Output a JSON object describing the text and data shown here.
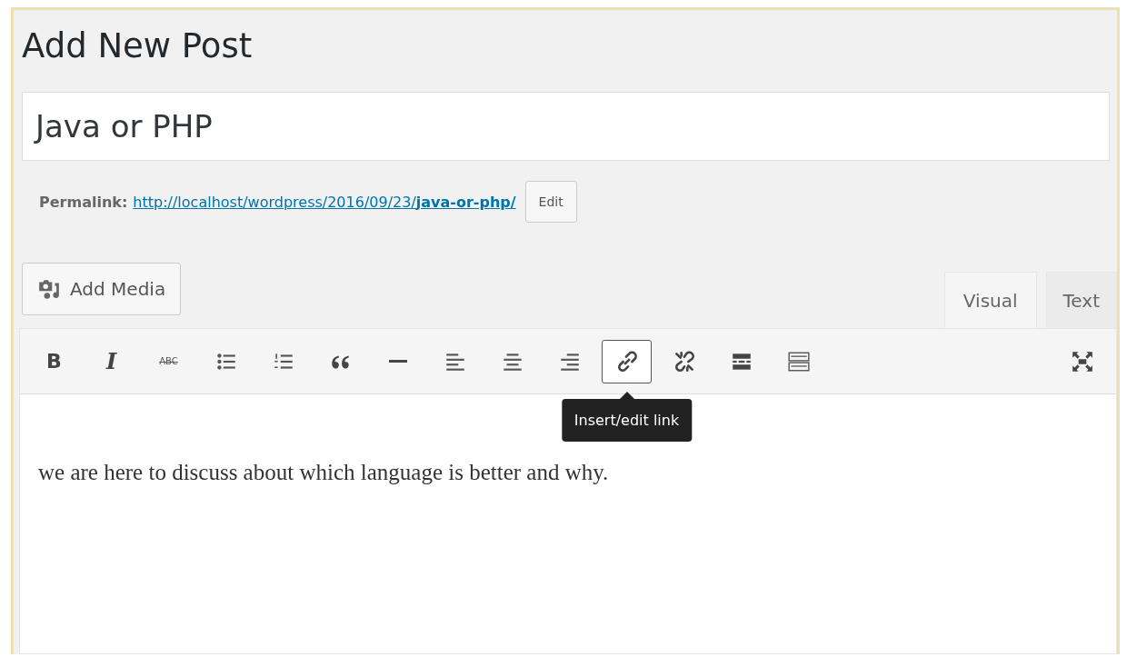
{
  "page_title": "Add New Post",
  "post_title": {
    "value": "Java or PHP"
  },
  "permalink": {
    "label": "Permalink:",
    "url": "http://localhost/wordpress/2016/09/23/",
    "slug": "java-or-php/",
    "edit_button": "Edit"
  },
  "add_media_button": "Add Media",
  "editor_tabs": [
    {
      "label": "Visual",
      "selected": true
    },
    {
      "label": "Text",
      "selected": false
    }
  ],
  "toolbar": [
    {
      "kind": "bold",
      "glyph": "B",
      "active": false
    },
    {
      "kind": "italic",
      "glyph": "I",
      "active": false
    },
    {
      "kind": "strikethrough",
      "glyph": "ABC",
      "active": false
    },
    {
      "kind": "bullet-list",
      "active": false
    },
    {
      "kind": "numbered-list",
      "active": false
    },
    {
      "kind": "quote",
      "active": false
    },
    {
      "kind": "horizontal-rule",
      "active": false
    },
    {
      "kind": "align-left",
      "active": false
    },
    {
      "kind": "align-center",
      "active": false
    },
    {
      "kind": "align-right",
      "active": false
    },
    {
      "kind": "link",
      "active": true
    },
    {
      "kind": "unlink",
      "active": false
    },
    {
      "kind": "read-more",
      "active": false
    },
    {
      "kind": "toolbar-toggle",
      "active": false
    },
    {
      "kind": "fullscreen",
      "active": false
    }
  ],
  "tooltip": "Insert/edit link",
  "content": "we are here to discuss about which language is better and why."
}
